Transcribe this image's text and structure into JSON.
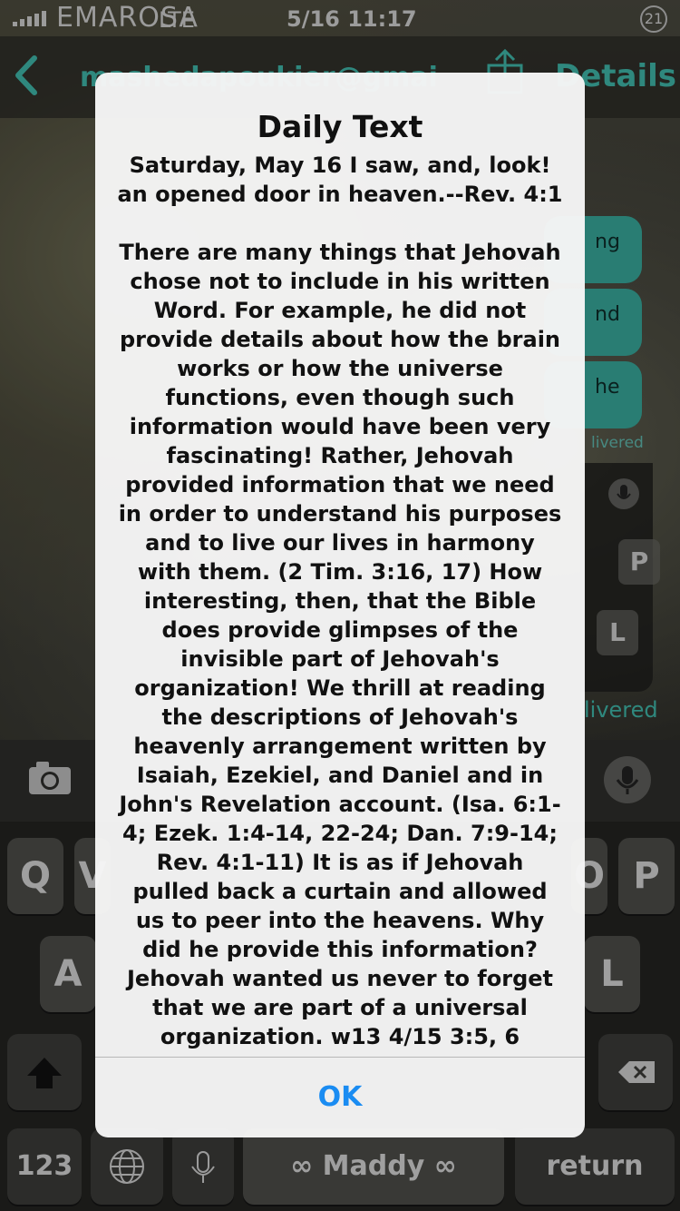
{
  "status_bar": {
    "carrier": "EMAROSA",
    "network": "LTE",
    "time": "5/16 11:17",
    "badge": "21"
  },
  "nav": {
    "back_icon": "chevron-left-icon",
    "contact": "mashedapoukier@gmai",
    "share_icon": "share-icon",
    "details": "Details"
  },
  "thread": {
    "bubbles": [
      "ng",
      "nd",
      "he"
    ],
    "delivered_small": "livered",
    "delivered": "livered"
  },
  "input": {
    "camera_icon": "camera-icon",
    "mic_icon": "microphone-icon"
  },
  "keyboard": {
    "row1_visible": [
      "Q",
      "V",
      "O",
      "P"
    ],
    "row2_visible": [
      "A",
      "L"
    ],
    "mini_keys": [
      "P",
      "L"
    ],
    "num_key": "123",
    "globe_icon": "globe-icon",
    "dictation_icon": "microphone-icon",
    "space_label": "∞ Maddy ∞",
    "return_label": "return",
    "shift_icon": "shift-icon",
    "delete_icon": "delete-icon"
  },
  "alert": {
    "title": "Daily Text",
    "message": "Saturday, May 16 I saw, and, look! an opened door in heaven.--Rev. 4:1\n\nThere are many things that Jehovah chose not to include in his written Word. For example, he did not provide details about how the brain works or how the universe functions, even though such information would have been very fascinating! Rather, Jehovah provided information that we need in order to understand his purposes and to live our lives in harmony with them. (2 Tim. 3:16, 17) How interesting, then, that the Bible does provide glimpses of the invisible part of Jehovah's organization! We thrill at reading the descriptions of Jehovah's heavenly arrangement written by Isaiah, Ezekiel, and Daniel and in John's Revelation account. (Isa. 6:1-4; Ezek. 1:4-14, 22-24; Dan. 7:9-14; Rev. 4:1-11) It is as if Jehovah pulled back a curtain and allowed us to peer into the heavens. Why did he provide this information? Jehovah wanted us never to forget that we are part of a universal organization. w13 4/15 3:5, 6",
    "ok_label": "OK"
  },
  "colors": {
    "accent": "#3fb6a8",
    "ok_blue": "#1a8cf2",
    "alert_bg": "#f6f6f6"
  }
}
